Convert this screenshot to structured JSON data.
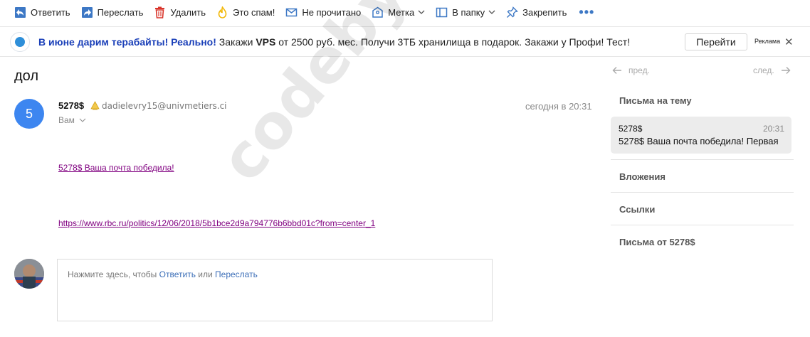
{
  "toolbar": {
    "reply": "Ответить",
    "forward": "Переслать",
    "delete": "Удалить",
    "spam": "Это спам!",
    "unread": "Не прочитано",
    "label": "Метка",
    "folder": "В папку",
    "pin": "Закрепить",
    "more": "•••"
  },
  "banner": {
    "highlight": "В июне дарим терабайты! Реально!",
    "text_pre": " Закажи ",
    "text_bold": "VPS",
    "text_post": " от 2500 руб. мес. Получи 3ТБ хранилища в подарок. Закажи у Профи! Тест!",
    "button": "Перейти",
    "ad_label": "Реклама",
    "close": "✕"
  },
  "subject": "дол",
  "message": {
    "avatar_letter": "5",
    "sender_name": "5278$",
    "sender_email": "dadielevry15@univmetiers.ci",
    "recipient": "Вам",
    "date": "сегодня в 20:31",
    "link1": "5278$ Ваша почта победила!",
    "link2": "https://www.rbc.ru/politics/12/06/2018/5b1bce2d9a794776b6bbd01c?from=center_1"
  },
  "reply": {
    "prefix": "Нажмите здесь, чтобы ",
    "reply_link": "Ответить",
    "middle": " или ",
    "forward_link": "Переслать"
  },
  "watermark": "codeby.net",
  "side": {
    "prev": "пред.",
    "next": "след.",
    "thread_title": "Письма на тему",
    "thread_item": {
      "from": "5278$",
      "time": "20:31",
      "subject": "5278$ Ваша почта победила! Первая"
    },
    "attachments": "Вложения",
    "links": "Ссылки",
    "from_sender": "Письма от 5278$"
  },
  "colors": {
    "accent": "#3d78c5",
    "avatar": "#3d86f0",
    "visited_link": "#800080",
    "delete_icon": "#d9352b",
    "spam_icon": "#f2b705"
  }
}
